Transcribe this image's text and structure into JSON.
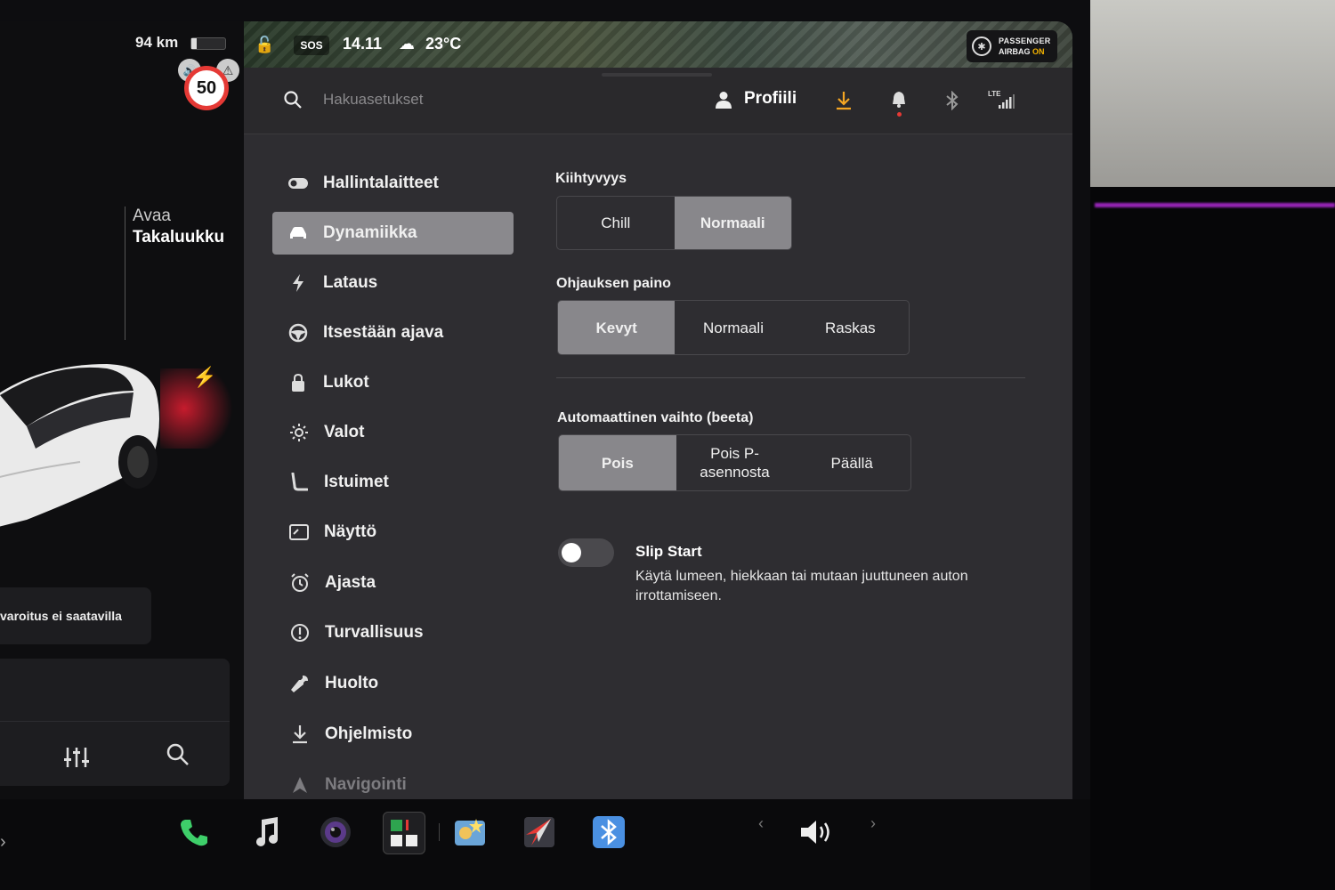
{
  "status": {
    "range": "94 km",
    "battery_level": 0.15,
    "speed_limit": "50",
    "sos": "SOS",
    "time": "14.11",
    "temperature": "23°C",
    "airbag_line1": "PASSENGER",
    "airbag_line2": "AIRBAG",
    "airbag_state": "ON"
  },
  "car_panel": {
    "trunk_line1": "Avaa",
    "trunk_line2": "Takaluukku",
    "warning": "varoitus ei saatavilla"
  },
  "topbar": {
    "search_placeholder": "Hakuasetukset",
    "profile_label": "Profiili",
    "lte_label": "LTE"
  },
  "sidebar": {
    "items": [
      {
        "label": "Hallintalaitteet",
        "icon": "toggle-icon"
      },
      {
        "label": "Dynamiikka",
        "icon": "car-icon",
        "active": true
      },
      {
        "label": "Lataus",
        "icon": "bolt-icon"
      },
      {
        "label": "Itsestään ajava",
        "icon": "steering-wheel-icon"
      },
      {
        "label": "Lukot",
        "icon": "lock-icon"
      },
      {
        "label": "Valot",
        "icon": "sun-icon"
      },
      {
        "label": "Istuimet",
        "icon": "seat-icon"
      },
      {
        "label": "Näyttö",
        "icon": "display-icon"
      },
      {
        "label": "Ajasta",
        "icon": "alarm-clock-icon"
      },
      {
        "label": "Turvallisuus",
        "icon": "alert-circle-icon"
      },
      {
        "label": "Huolto",
        "icon": "wrench-icon"
      },
      {
        "label": "Ohjelmisto",
        "icon": "download-icon"
      },
      {
        "label": "Navigointi",
        "icon": "navigation-icon"
      }
    ]
  },
  "settings": {
    "acceleration": {
      "title": "Kiihtyvyys",
      "options": [
        "Chill",
        "Normaali"
      ],
      "selected": "Normaali"
    },
    "steering": {
      "title": "Ohjauksen paino",
      "options": [
        "Kevyt",
        "Normaali",
        "Raskas"
      ],
      "selected": "Kevyt"
    },
    "auto_shift": {
      "title": "Automaattinen vaihto (beeta)",
      "options": [
        "Pois",
        "Pois P-\nasennosta",
        "Päällä"
      ],
      "selected": "Pois"
    },
    "slip_start": {
      "title": "Slip Start",
      "description": "Käytä lumeen, hiekkaan tai mutaan juuttuneen auton irrottamiseen.",
      "enabled": false
    }
  },
  "colors": {
    "accent_download": "#f5a623",
    "selected_segment": "#88878b",
    "speed_sign_border": "#e53935"
  }
}
